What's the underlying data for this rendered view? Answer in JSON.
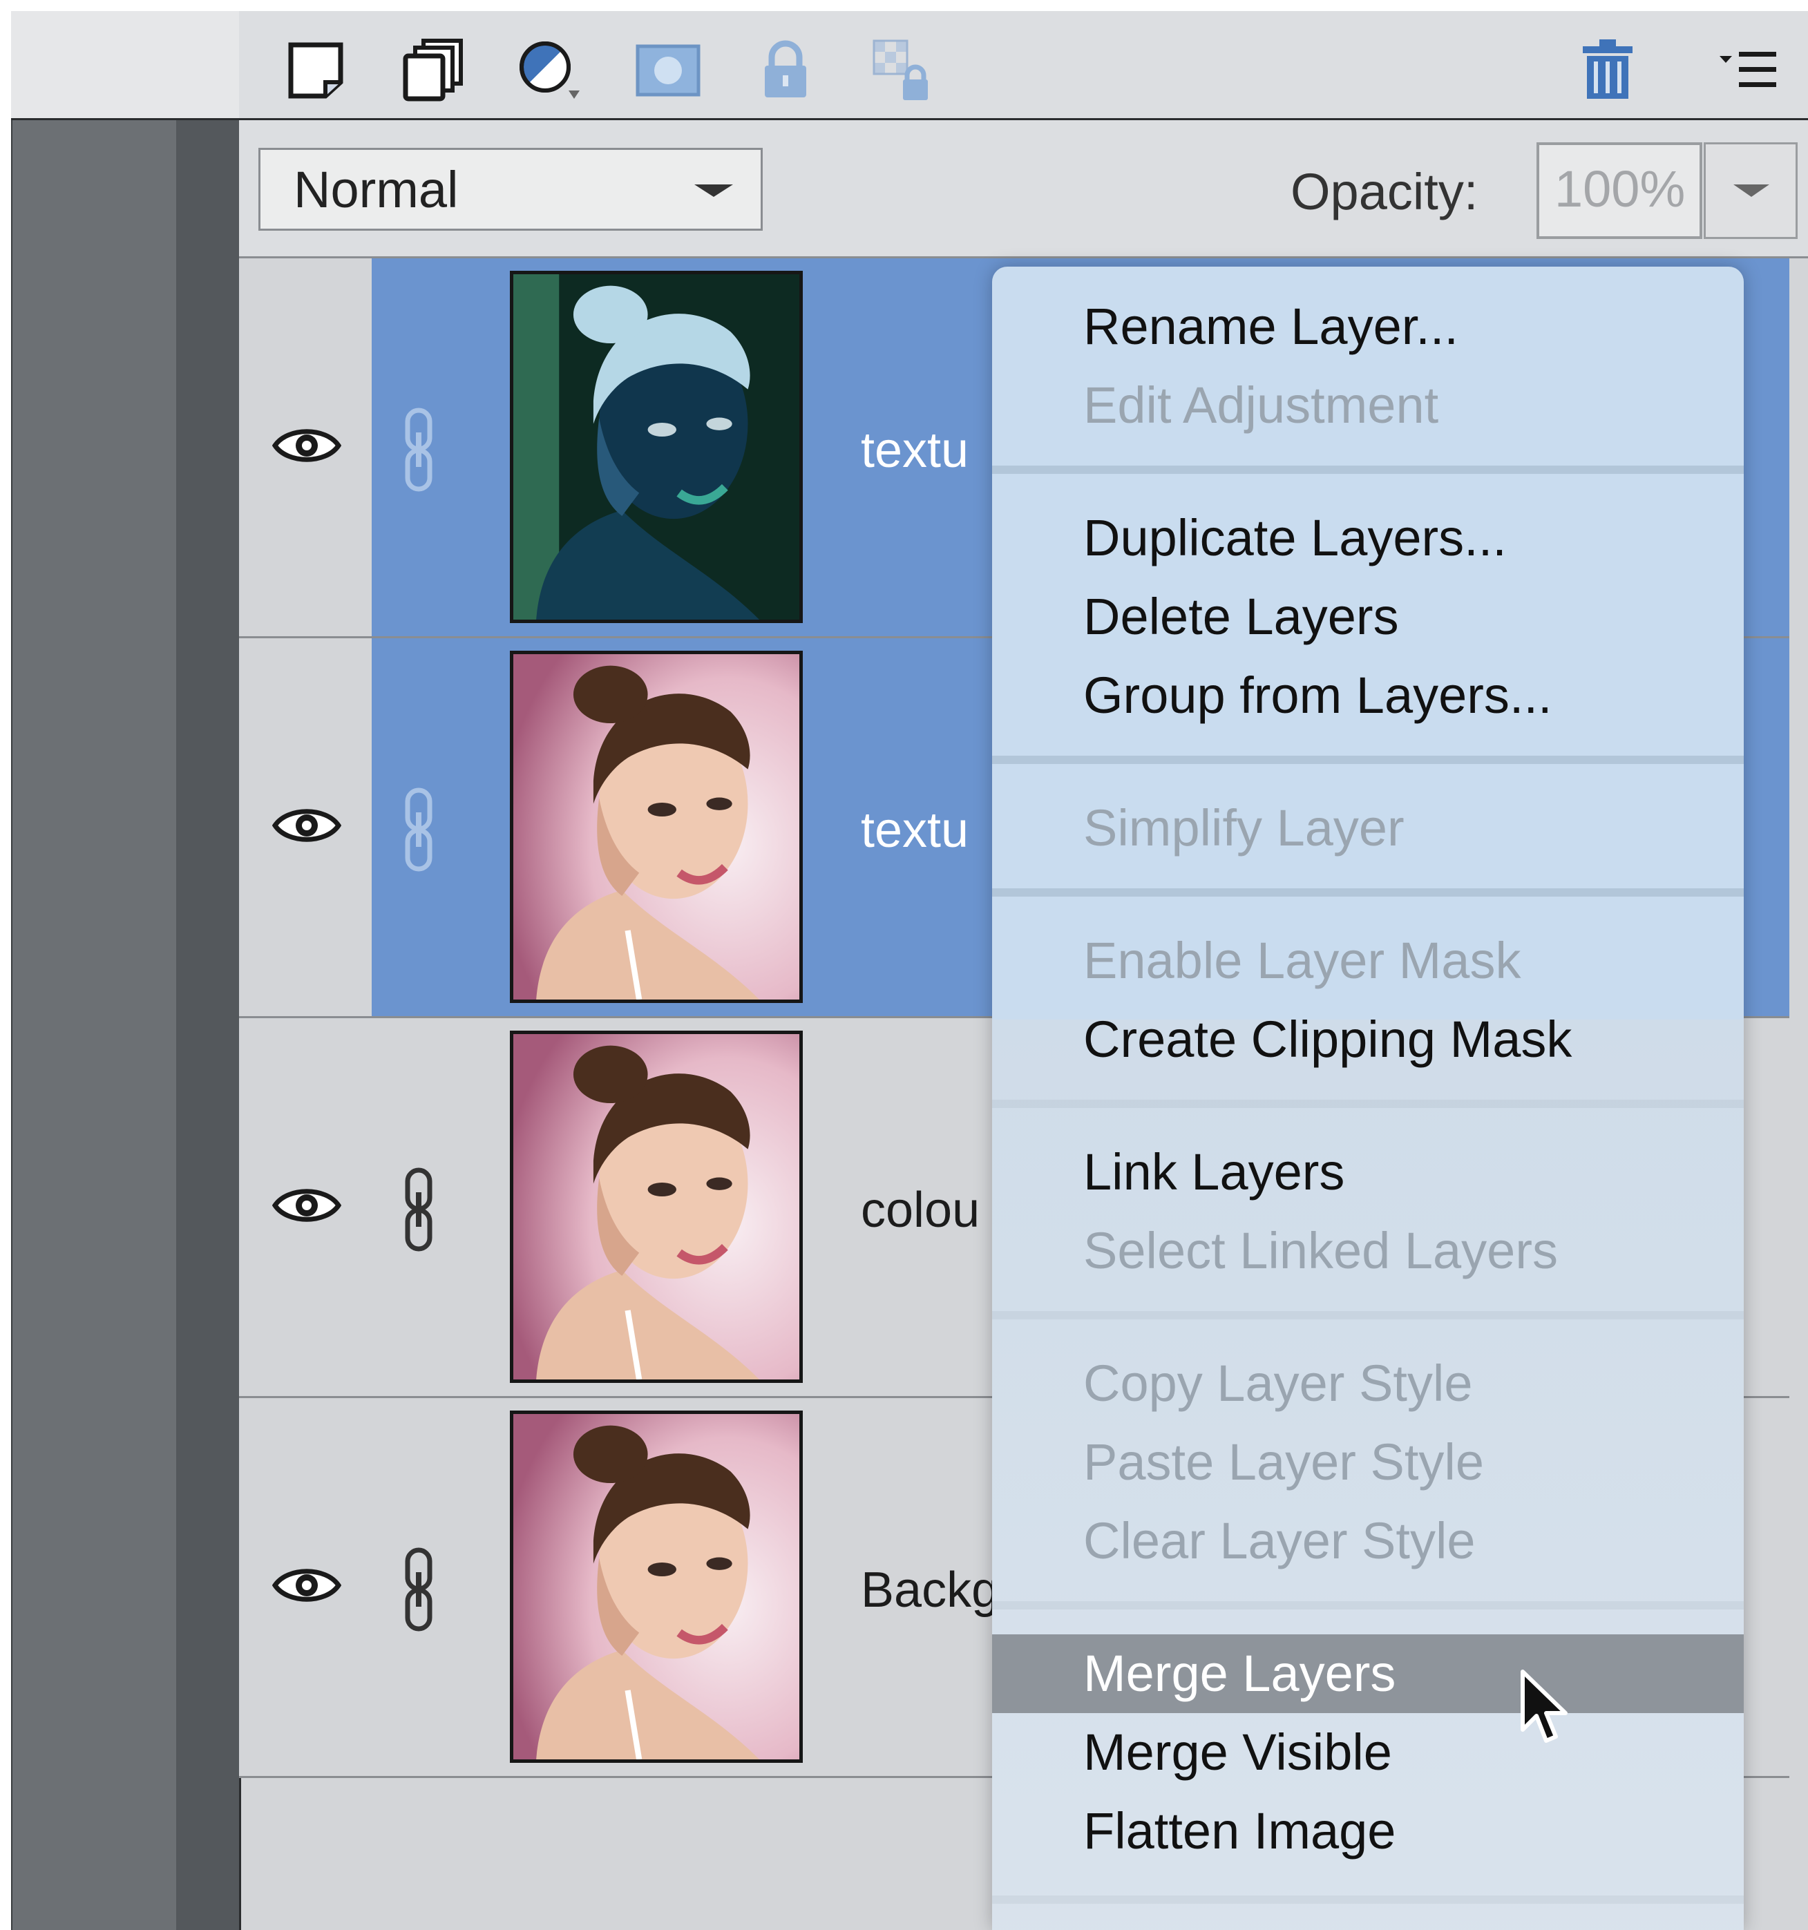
{
  "colors": {
    "panel_bg": "#d3d5d8",
    "selection_blue": "#6b94cf",
    "menu_bg": "#c9dcef",
    "menu_highlight": "#8e949b",
    "icon_blue": "#3f73b9"
  },
  "toolbar": {
    "icons": [
      "new-layer-icon",
      "new-group-icon",
      "adjustment-layer-icon",
      "add-mask-icon",
      "lock-icon",
      "lock-transparent-icon",
      "trash-icon",
      "panel-menu-icon"
    ]
  },
  "blend": {
    "mode": "Normal",
    "opacity_label": "Opacity:",
    "opacity_value": "100%"
  },
  "layers": [
    {
      "name": "textu",
      "selected": true,
      "thumb": "inverted-portrait"
    },
    {
      "name": "textu",
      "selected": true,
      "thumb": "portrait"
    },
    {
      "name": "colou",
      "selected": false,
      "thumb": "portrait"
    },
    {
      "name": "Backg",
      "selected": false,
      "thumb": "portrait"
    }
  ],
  "menu": {
    "items": [
      {
        "label": "Rename Layer...",
        "state": "enabled"
      },
      {
        "label": "Edit Adjustment",
        "state": "disabled"
      },
      {
        "label": "Duplicate Layers...",
        "state": "enabled"
      },
      {
        "label": "Delete Layers",
        "state": "enabled"
      },
      {
        "label": "Group from Layers...",
        "state": "enabled"
      },
      {
        "label": "Simplify Layer",
        "state": "disabled"
      },
      {
        "label": "Enable Layer Mask",
        "state": "disabled"
      },
      {
        "label": "Create Clipping Mask",
        "state": "enabled"
      },
      {
        "label": "Link Layers",
        "state": "enabled"
      },
      {
        "label": "Select Linked Layers",
        "state": "disabled"
      },
      {
        "label": "Copy Layer Style",
        "state": "disabled"
      },
      {
        "label": "Paste Layer Style",
        "state": "disabled"
      },
      {
        "label": "Clear Layer Style",
        "state": "disabled"
      },
      {
        "label": "Merge Layers",
        "state": "highlighted"
      },
      {
        "label": "Merge Visible",
        "state": "enabled"
      },
      {
        "label": "Flatten Image",
        "state": "enabled"
      }
    ]
  }
}
